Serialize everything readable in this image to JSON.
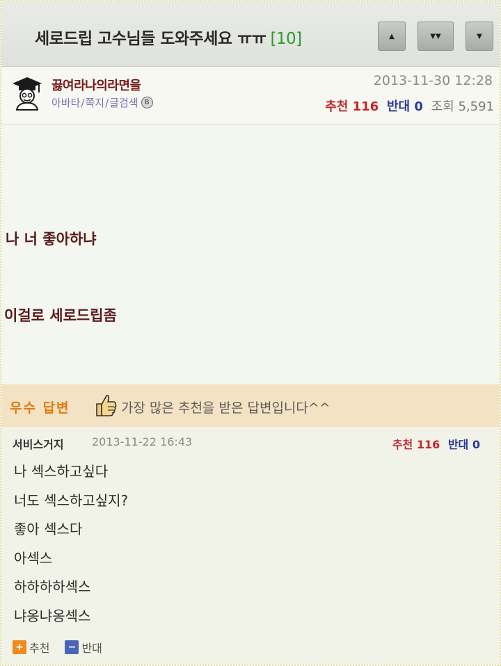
{
  "header": {
    "title": "세로드립 고수님들 도와주세요 ㅠㅠ",
    "comment_count": "[10]",
    "nav_buttons": [
      "▲",
      "▼▼",
      "▼"
    ]
  },
  "post": {
    "author": "끓여라나의라면을",
    "author_links": [
      "아바타",
      "쪽지",
      "글검색"
    ],
    "badge": "B",
    "date": "2013-11-30 12:28",
    "recommend_label": "추천",
    "recommend_count": "116",
    "oppose_label": "반대",
    "oppose_count": "0",
    "views_label": "조회",
    "views_count": "5,591",
    "body_lines": [
      "나 너 좋아하냐",
      "이걸로 세로드립좀"
    ]
  },
  "best_answer": {
    "label": "우수 답변",
    "description": "가장 많은 추천을 받은 답변입니다^^"
  },
  "answer": {
    "nickname": "서비스거지",
    "date": "2013-11-22 16:43",
    "recommend_label": "추천",
    "recommend_count": "116",
    "oppose_label": "반대",
    "oppose_count": "0",
    "lines": [
      "나 섹스하고싶다",
      "너도 섹스하고싶지?",
      "좋아 섹스다",
      "아섹스",
      "하하하하섹스",
      "냐옹냐옹섹스"
    ],
    "vote_up_label": "추천",
    "vote_down_label": "반대"
  },
  "colors": {
    "recommend": "#c1272d",
    "oppose": "#2b3a99",
    "count_green": "#2d9a2d",
    "best_orange": "#e07a10"
  }
}
